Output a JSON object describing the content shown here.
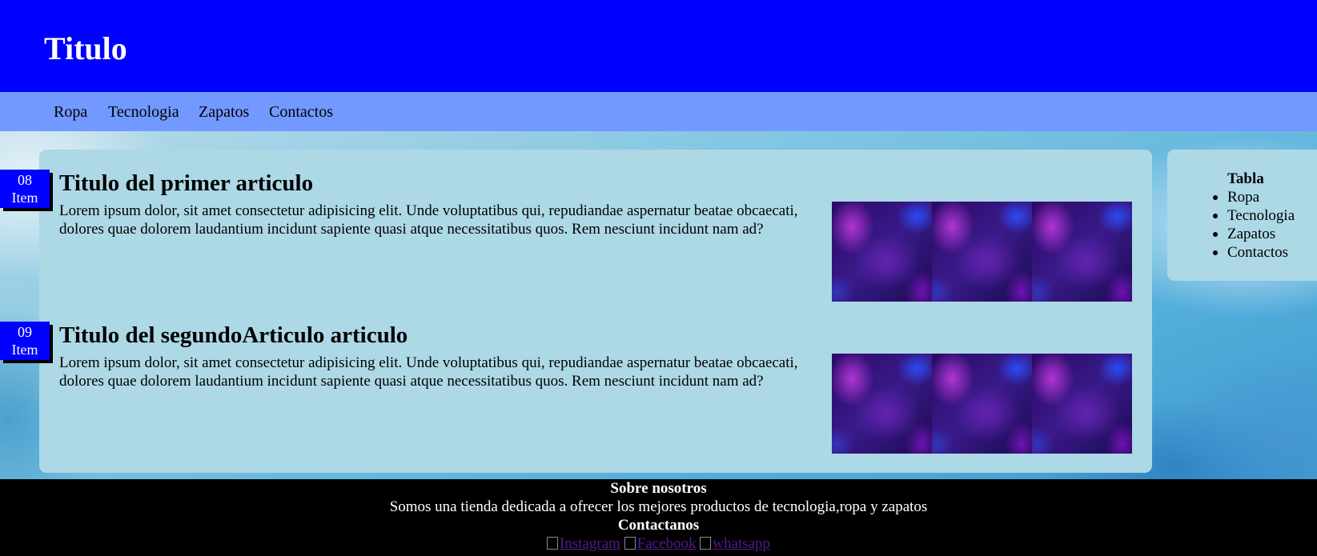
{
  "header": {
    "title": "Titulo"
  },
  "nav": {
    "items": [
      "Ropa",
      "Tecnologia",
      "Zapatos",
      "Contactos"
    ]
  },
  "articles": [
    {
      "badge_number": "08",
      "badge_label": "Item",
      "title": "Titulo del primer articulo",
      "text": "Lorem ipsum dolor, sit amet consectetur adipisicing elit. Unde voluptatibus qui, repudiandae aspernatur beatae obcaecati, dolores quae dolorem laudantium incidunt sapiente quasi atque necessitatibus quos. Rem nesciunt incidunt nam ad?"
    },
    {
      "badge_number": "09",
      "badge_label": "Item",
      "title": "Titulo del segundoArticulo articulo",
      "text": "Lorem ipsum dolor, sit amet consectetur adipisicing elit. Unde voluptatibus qui, repudiandae aspernatur beatae obcaecati, dolores quae dolorem laudantium incidunt sapiente quasi atque necessitatibus quos. Rem nesciunt incidunt nam ad?"
    }
  ],
  "aside": {
    "title": "Tabla",
    "items": [
      "Ropa",
      "Tecnologia",
      "Zapatos",
      "Contactos"
    ]
  },
  "footer": {
    "about_title": "Sobre nosotros",
    "about_text": "Somos una tienda dedicada a ofrecer los mejores productos de tecnologia,ropa y zapatos",
    "contact_title": "Contactanos",
    "social": [
      "Instagram",
      "Facebook",
      "whatsapp"
    ]
  },
  "colors": {
    "header": "#0000ff",
    "nav": "#7299ff",
    "panel": "#add8e6",
    "footer": "#000000",
    "badge": "#0000ff"
  }
}
